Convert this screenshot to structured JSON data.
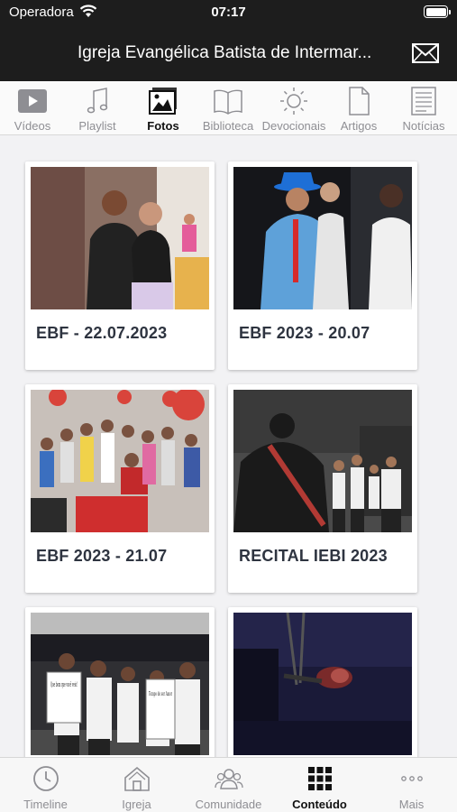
{
  "status_bar": {
    "carrier": "Operadora",
    "time": "07:17"
  },
  "header": {
    "title": "Igreja Evangélica Batista de Intermar..."
  },
  "tabs": [
    {
      "label": "Vídeos",
      "icon": "play-icon",
      "active": false
    },
    {
      "label": "Playlist",
      "icon": "music-note-icon",
      "active": false
    },
    {
      "label": "Fotos",
      "icon": "photos-icon",
      "active": true
    },
    {
      "label": "Biblioteca",
      "icon": "book-icon",
      "active": false
    },
    {
      "label": "Devocionais",
      "icon": "sun-icon",
      "active": false
    },
    {
      "label": "Artigos",
      "icon": "document-icon",
      "active": false
    },
    {
      "label": "Notícias",
      "icon": "newspaper-icon",
      "active": false
    }
  ],
  "albums": [
    {
      "title": "EBF - 22.07.2023"
    },
    {
      "title": "EBF 2023 - 20.07"
    },
    {
      "title": "EBF 2023 - 21.07"
    },
    {
      "title": "RECITAL IEBI 2023"
    },
    {
      "title": ""
    },
    {
      "title": ""
    }
  ],
  "photo_texts": {
    "sign1": "Que bom que você veio!",
    "sign2": "Tempo de ser Amor"
  },
  "bottom_tabs": [
    {
      "label": "Timeline",
      "icon": "clock-icon",
      "active": false
    },
    {
      "label": "Igreja",
      "icon": "church-icon",
      "active": false
    },
    {
      "label": "Comunidade",
      "icon": "people-icon",
      "active": false
    },
    {
      "label": "Conteúdo",
      "icon": "grid-icon",
      "active": true
    },
    {
      "label": "Mais",
      "icon": "more-icon",
      "active": false
    }
  ],
  "colors": {
    "header_bg": "#1d1d1d",
    "active_tab": "#111111",
    "inactive_tab": "#8e8e93",
    "title_text": "#2e3440"
  }
}
